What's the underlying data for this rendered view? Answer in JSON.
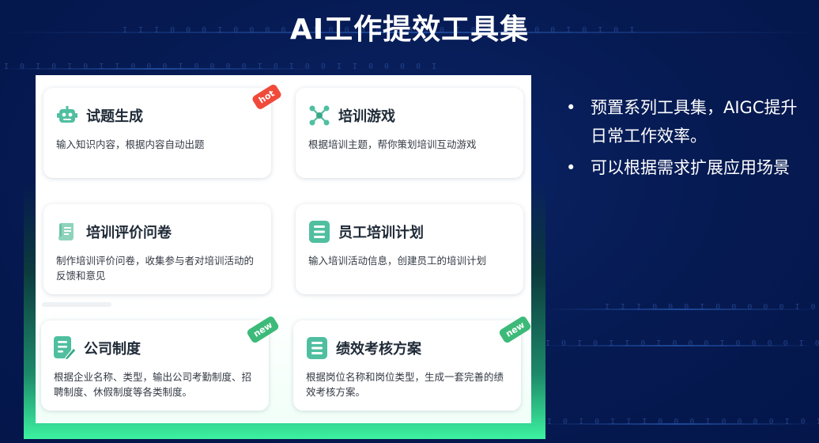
{
  "title": "AI工作提效工具集",
  "cards": [
    {
      "title": "试题生成",
      "desc": "输入知识内容，根据内容自动出题",
      "badge": "hot",
      "icon": "robot-icon"
    },
    {
      "title": "培训游戏",
      "desc": "根据培训主题，帮你策划培训互动游戏",
      "badge": "",
      "icon": "network-icon"
    },
    {
      "title": "培训评价问卷",
      "desc": "制作培训评价问卷，收集参与者对培训活动的反馈和意见",
      "badge": "",
      "icon": "scroll-icon"
    },
    {
      "title": "员工培训计划",
      "desc": "输入培训活动信息，创建员工的培训计划",
      "badge": "",
      "icon": "list-icon"
    },
    {
      "title": "公司制度",
      "desc": "根据企业名称、类型，输出公司考勤制度、招聘制度、休假制度等各类制度。",
      "badge": "new",
      "icon": "document-edit-icon"
    },
    {
      "title": "绩效考核方案",
      "desc": "根据岗位名称和岗位类型，生成一套完善的绩效考核方案。",
      "badge": "new",
      "icon": "list-icon"
    }
  ],
  "bullets": [
    {
      "dot": "•",
      "text": "预置系列工具集，AIGC提升日常工作效率。"
    },
    {
      "dot": "•",
      "text": "可以根据需求扩展应用场景"
    }
  ],
  "binary_rows": [
    "I I I 0 0 0 I 0 0 0 0 0 I 0 0 0 0 I 0 I 0 I 0 I 0 I 0 0 I 0 I 0 I",
    "I 0 I 0 I 0 I I 0 0 0 I 0 0 0 0 I 0 I 0 0 I I 0 0 0 0 I",
    "I I I 0 0 0 I 0 0 0 0 0 I 0 0 0 0 I 0 I 0 I 0",
    "I 0 I 0 I I 0 I 0 0 0 I 0 0 0 0 I 0 I 0 0 I",
    "I 0 I 0 I I I 0 0 0 I 0 0 0 0 I 0 I 0 0 0 I 0"
  ],
  "colors": {
    "background": "#061a52",
    "hot_badge": "#f04a3a",
    "new_badge": "#3dba79",
    "icon_teal": "#4fbfa0"
  }
}
